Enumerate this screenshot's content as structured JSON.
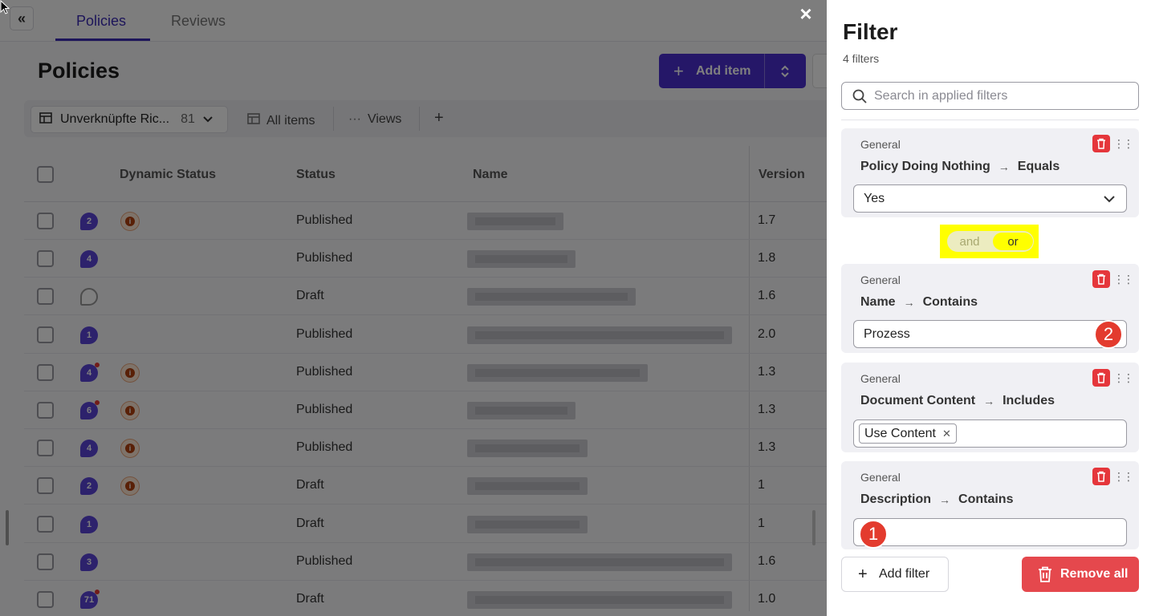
{
  "topbar": {
    "collapse_icon": "«",
    "tabs": [
      {
        "label": "Policies",
        "active": true
      },
      {
        "label": "Reviews",
        "active": false
      }
    ],
    "close_icon": "×"
  },
  "page": {
    "title": "Policies",
    "add_item_label": "Add item",
    "add_item_plus": "+",
    "add_item_chevron": "⌃⌄"
  },
  "viewbar": {
    "view_name": "Unverknüpfte Ric...",
    "view_count": "81",
    "all_items": "All items",
    "views": "Views",
    "add": "+"
  },
  "table": {
    "headers": {
      "dynamic_status": "Dynamic Status",
      "status": "Status",
      "name": "Name",
      "version": "Version"
    },
    "rows": [
      {
        "comments": "2",
        "unread": false,
        "warn": true,
        "status": "Published",
        "version": "1.7"
      },
      {
        "comments": "4",
        "unread": false,
        "warn": false,
        "status": "Published",
        "version": "1.8"
      },
      {
        "comments": "",
        "unread": false,
        "warn": false,
        "status": "Draft",
        "version": "1.6"
      },
      {
        "comments": "1",
        "unread": false,
        "warn": false,
        "status": "Published",
        "version": "2.0"
      },
      {
        "comments": "4",
        "unread": true,
        "warn": true,
        "status": "Published",
        "version": "1.3"
      },
      {
        "comments": "6",
        "unread": true,
        "warn": true,
        "status": "Published",
        "version": "1.3"
      },
      {
        "comments": "4",
        "unread": false,
        "warn": true,
        "status": "Published",
        "version": "1.3"
      },
      {
        "comments": "2",
        "unread": false,
        "warn": true,
        "status": "Draft",
        "version": "1"
      },
      {
        "comments": "1",
        "unread": false,
        "warn": false,
        "status": "Draft",
        "version": "1"
      },
      {
        "comments": "3",
        "unread": false,
        "warn": false,
        "status": "Published",
        "version": "1.6"
      },
      {
        "comments": "71",
        "unread": true,
        "warn": false,
        "status": "Draft",
        "version": "1.0"
      }
    ]
  },
  "filter": {
    "title": "Filter",
    "subtitle": "4 filters",
    "search_placeholder": "Search in applied filters",
    "logic": {
      "and": "and",
      "or": "or",
      "selected": "or"
    },
    "cards": [
      {
        "category": "General",
        "field": "Policy Doing Nothing",
        "operator": "Equals",
        "value": "Yes",
        "kind": "select"
      },
      {
        "category": "General",
        "field": "Name",
        "operator": "Contains",
        "value": "Prozess",
        "kind": "text"
      },
      {
        "category": "General",
        "field": "Document Content",
        "operator": "Includes",
        "chip": "Use Content",
        "kind": "chips"
      },
      {
        "category": "General",
        "field": "Description",
        "operator": "Contains",
        "value": "",
        "kind": "text"
      }
    ],
    "badges": {
      "first": "1",
      "second": "2"
    },
    "add_filter_label": "Add filter",
    "remove_all_label": "Remove all"
  },
  "colors": {
    "brand": "#4a2fd1",
    "danger": "#e5484d",
    "highlight": "#ffff00",
    "badge": "#e33b2e"
  }
}
